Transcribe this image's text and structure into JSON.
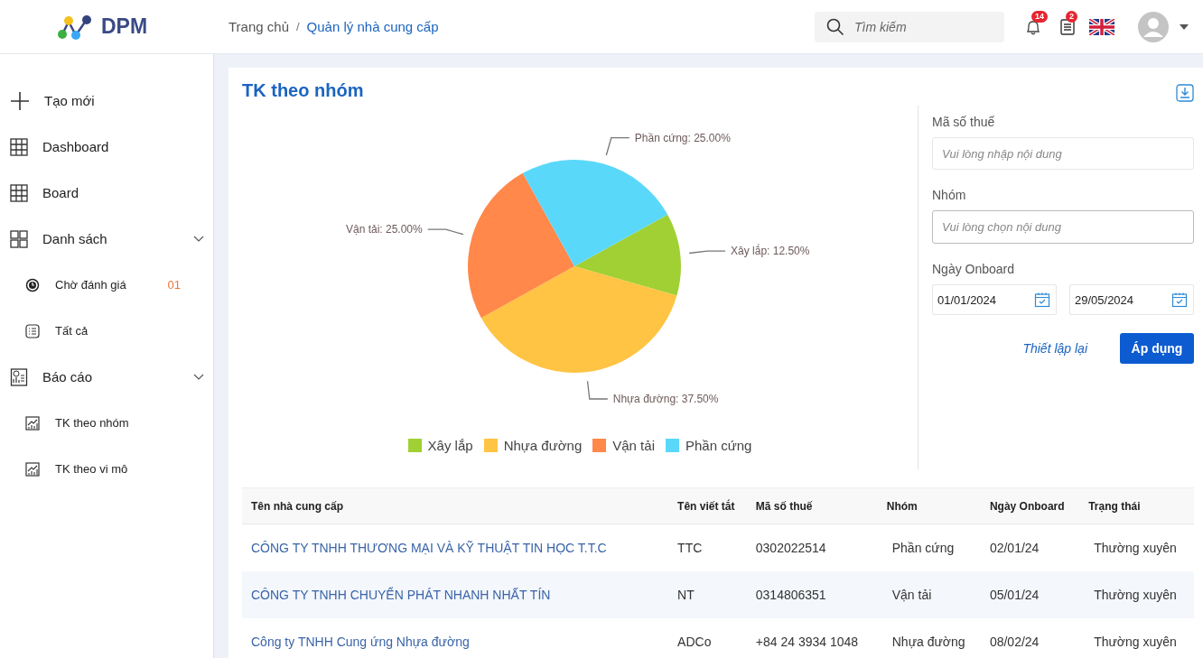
{
  "header": {
    "logo_text": "DPM",
    "breadcrumb_separator": "/",
    "breadcrumb": [
      {
        "label": "Trang chủ",
        "current": false
      },
      {
        "label": "Quản lý nhà cung cấp",
        "current": true
      }
    ],
    "search": {
      "placeholder": "Tìm kiếm"
    },
    "notifications_badge": "14",
    "documents_badge": "2"
  },
  "sidebar": {
    "items": [
      {
        "label": "Tạo mới"
      },
      {
        "label": "Dashboard"
      },
      {
        "label": "Board"
      },
      {
        "label": "Danh sách",
        "expanded": true,
        "children": [
          {
            "label": "Chờ đánh giá",
            "badge": "01"
          },
          {
            "label": "Tất cả"
          }
        ]
      },
      {
        "label": "Báo cáo",
        "expanded": true,
        "children": [
          {
            "label": "TK theo nhóm"
          },
          {
            "label": "TK theo vi mô"
          }
        ]
      }
    ]
  },
  "card": {
    "title": "TK theo nhóm",
    "chart_data": {
      "type": "pie",
      "categories": [
        "Xây lắp",
        "Nhựa đường",
        "Vận tải",
        "Phần cứng"
      ],
      "values": [
        12.5,
        37.5,
        25,
        25
      ],
      "value_labels": [
        "Xây lắp: 12.50%",
        "Nhựa đường: 37.50%",
        "Vận tải: 25.00%",
        "Phần cứng: 25.00%"
      ]
    },
    "legend": [
      {
        "color": "#a0d033"
      },
      {
        "color": "#ffc444"
      },
      {
        "color": "#ff884a"
      },
      {
        "color": "#5ad8fa"
      }
    ],
    "filters": {
      "tax_label": "Mã số thuế",
      "tax_placeholder": "Vui lòng nhập nội dung",
      "group_label": "Nhóm",
      "group_placeholder": "Vui lòng chọn nội dung",
      "date_label": "Ngày Onboard",
      "date_from": "01/01/2024",
      "date_to": "29/05/2024",
      "reset": "Thiết lập lại",
      "apply": "Áp dụng"
    }
  },
  "table": {
    "columns": [
      "Tên nhà cung cấp",
      "Tên viết tắt",
      "Mã số thuế",
      "Nhóm",
      "Ngày Onboard",
      "Trạng thái"
    ],
    "rows": [
      [
        "CÔNG TY TNHH THƯƠNG MẠI VÀ KỸ THUẬT TIN HỌC T.T.C",
        "TTC",
        "0302022514",
        "Phần cứng",
        "02/01/24",
        "Thường xuyên"
      ],
      [
        "CÔNG TY TNHH CHUYỂN PHÁT NHANH NHẤT TÍN",
        "NT",
        "0314806351",
        "Vận tải",
        "05/01/24",
        "Thường xuyên"
      ],
      [
        "Công ty TNHH Cung ứng Nhựa đường",
        "ADCo",
        "+84 24 3934 1048",
        "Nhựa đường",
        "08/02/24",
        "Thường xuyên"
      ]
    ]
  }
}
